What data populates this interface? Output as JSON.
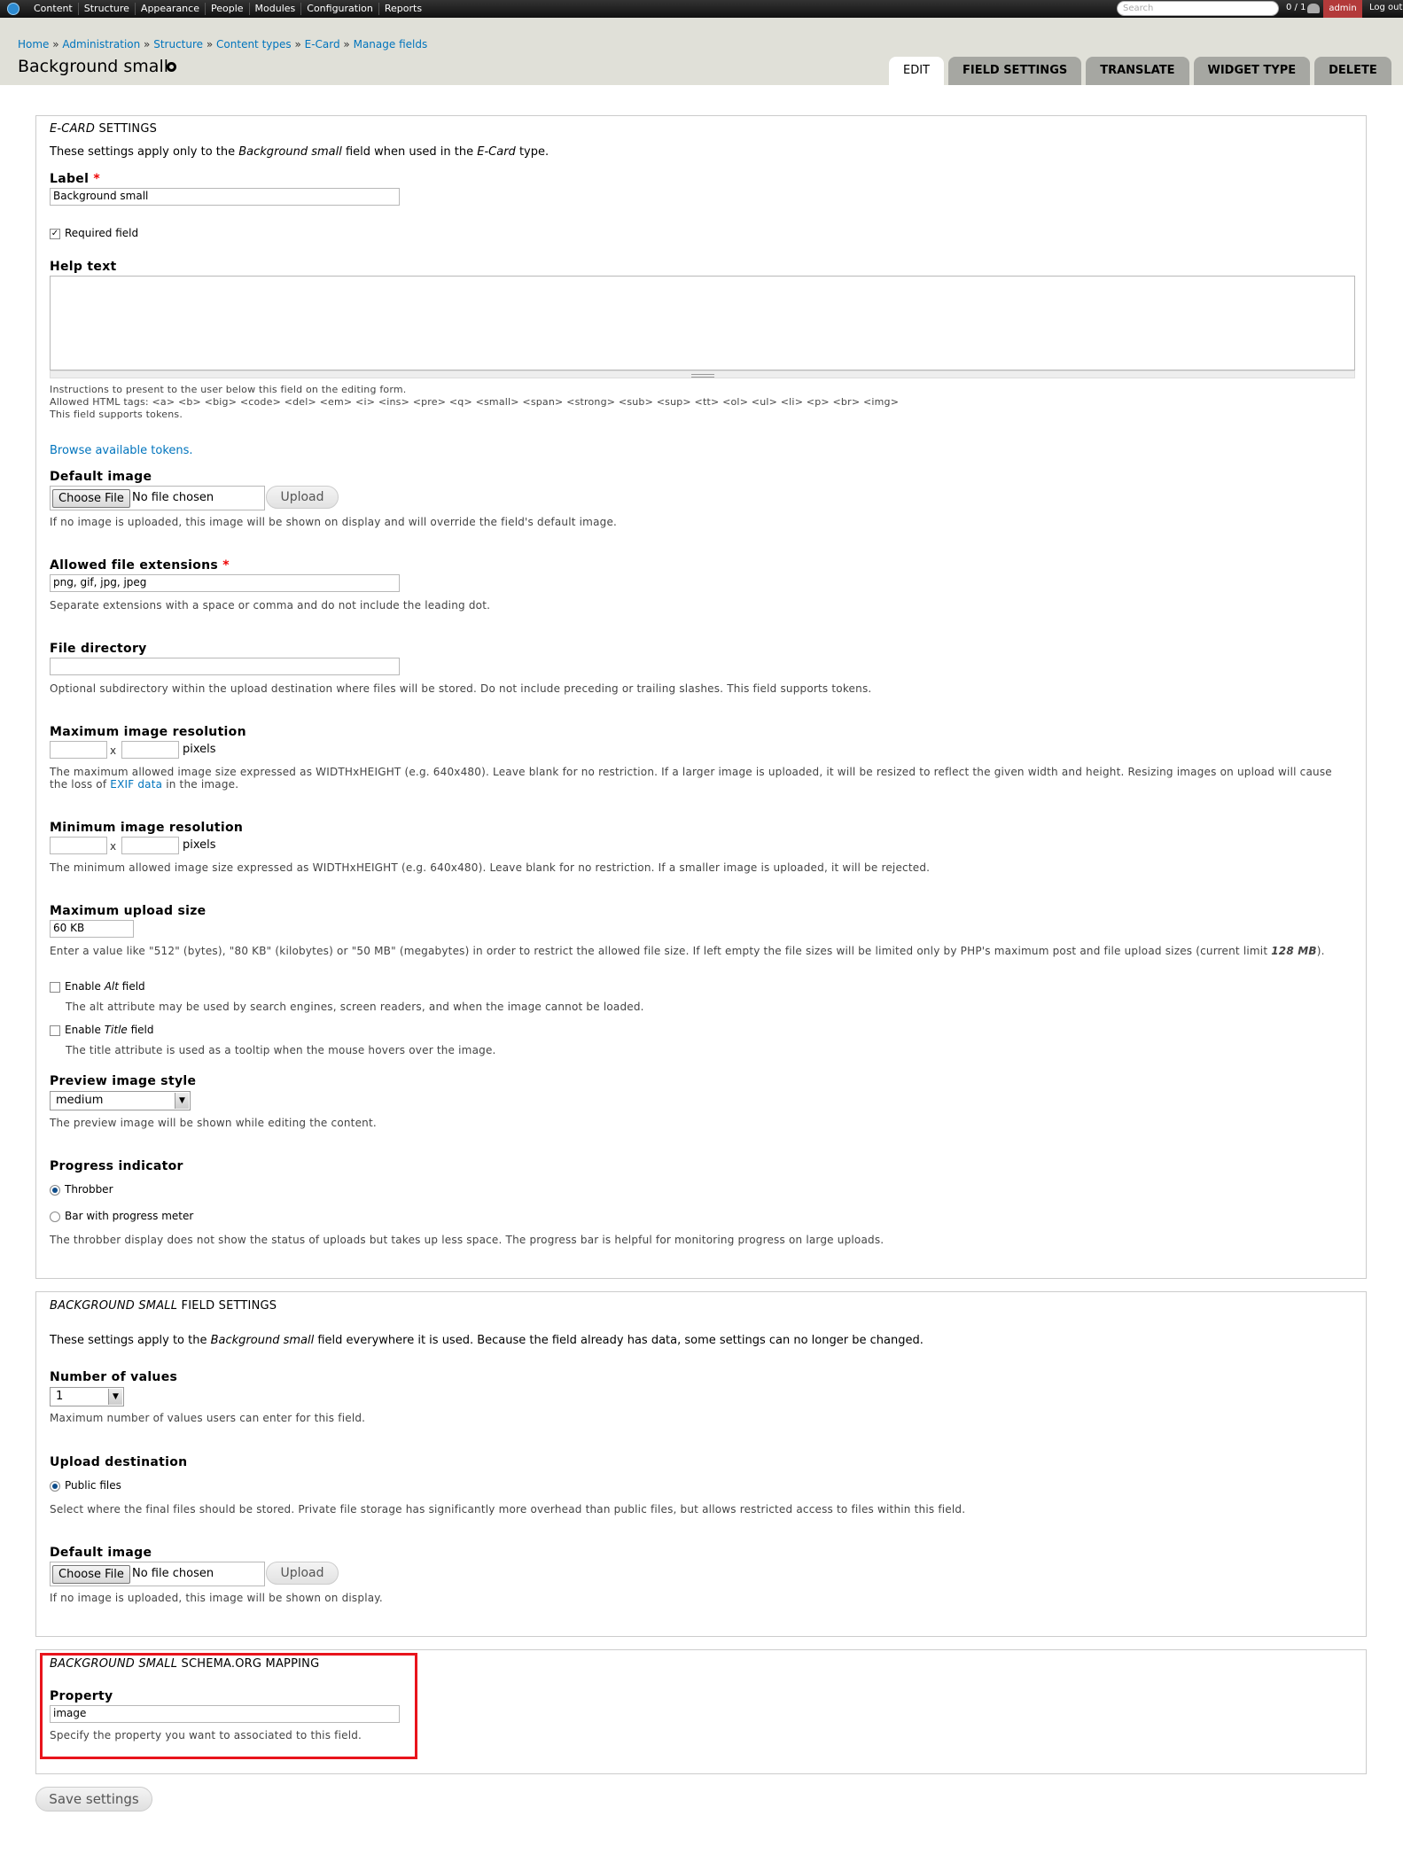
{
  "toolbar": {
    "menu": [
      "Content",
      "Structure",
      "Appearance",
      "People",
      "Modules",
      "Configuration",
      "Reports"
    ],
    "search_placeholder": "Search",
    "users_count": "0 / 1",
    "username": "admin",
    "logout": "Log out"
  },
  "header": {
    "breadcrumb": [
      "Home",
      "Administration",
      "Structure",
      "Content types",
      "E-Card",
      "Manage fields"
    ],
    "title": "Background small",
    "tabs": [
      "EDIT",
      "FIELD SETTINGS",
      "TRANSLATE",
      "WIDGET TYPE",
      "DELETE"
    ]
  },
  "ecard": {
    "legend_em": "E-Card",
    "legend_rest": " settings",
    "intro_pre": "These settings apply only to the ",
    "intro_field": "Background small",
    "intro_mid": " field when used in the ",
    "intro_type": "E-Card",
    "intro_post": " type.",
    "label_label": "Label",
    "label_value": "Background small",
    "required_label": "Required field",
    "help_label": "Help text",
    "help_desc1": "Instructions to present to the user below this field on the editing form.",
    "help_desc2": "Allowed HTML tags: <a> <b> <big> <code> <del> <em> <i> <ins> <pre> <q> <small> <span> <strong> <sub> <sup> <tt> <ol> <ul> <li> <p> <br> <img>",
    "help_desc3": "This field supports tokens.",
    "tokens_link": "Browse available tokens.",
    "default_image_label": "Default image",
    "choose_file": "Choose File",
    "no_file": "No file chosen",
    "upload": "Upload",
    "default_image_desc": "If no image is uploaded, this image will be shown on display and will override the field's default image.",
    "extensions_label": "Allowed file extensions",
    "extensions_value": "png, gif, jpg, jpeg",
    "extensions_desc": "Separate extensions with a space or comma and do not include the leading dot.",
    "directory_label": "File directory",
    "directory_value": "",
    "directory_desc": "Optional subdirectory within the upload destination where files will be stored. Do not include preceding or trailing slashes. This field supports tokens.",
    "max_res_label": "Maximum image resolution",
    "x": "x",
    "pixels": "pixels",
    "max_res_desc1": "The maximum allowed image size expressed as WIDTHxHEIGHT (e.g. 640x480). Leave blank for no restriction. If a larger image is uploaded, it will be resized to reflect the given width and height. Resizing images on upload will cause the loss of ",
    "max_res_link": "EXIF data",
    "max_res_desc2": " in the image.",
    "min_res_label": "Minimum image resolution",
    "min_res_desc": "The minimum allowed image size expressed as WIDTHxHEIGHT (e.g. 640x480). Leave blank for no restriction. If a smaller image is uploaded, it will be rejected.",
    "max_upload_label": "Maximum upload size",
    "max_upload_value": "60 KB",
    "max_upload_desc_pre": "Enter a value like \"512\" (bytes), \"80 KB\" (kilobytes) or \"50 MB\" (megabytes) in order to restrict the allowed file size. If left empty the file sizes will be limited only by PHP's maximum post and file upload sizes (current limit ",
    "max_upload_limit": "128 MB",
    "max_upload_desc_post": ").",
    "alt_pre": "Enable ",
    "alt_em": "Alt",
    "alt_post": " field",
    "alt_desc": "The alt attribute may be used by search engines, screen readers, and when the image cannot be loaded.",
    "title_pre": "Enable ",
    "title_em": "Title",
    "title_post": " field",
    "title_desc": "The title attribute is used as a tooltip when the mouse hovers over the image.",
    "preview_label": "Preview image style",
    "preview_value": "medium",
    "preview_desc": "The preview image will be shown while editing the content.",
    "progress_label": "Progress indicator",
    "progress_opt1": "Throbber",
    "progress_opt2": "Bar with progress meter",
    "progress_desc": "The throbber display does not show the status of uploads but takes up less space. The progress bar is helpful for monitoring progress on large uploads."
  },
  "field_settings": {
    "legend_em": "Background small",
    "legend_rest": " field settings",
    "intro_pre": "These settings apply to the ",
    "intro_field": "Background small",
    "intro_post": " field everywhere it is used. Because the field already has data, some settings can no longer be changed.",
    "num_values_label": "Number of values",
    "num_values_value": "1",
    "num_values_desc": "Maximum number of values users can enter for this field.",
    "upload_dest_label": "Upload destination",
    "upload_dest_opt": "Public files",
    "upload_dest_desc": "Select where the final files should be stored. Private file storage has significantly more overhead than public files, but allows restricted access to files within this field.",
    "default_image_label": "Default image",
    "choose_file": "Choose File",
    "no_file": "No file chosen",
    "upload": "Upload",
    "default_image_desc": "If no image is uploaded, this image will be shown on display."
  },
  "schema": {
    "legend_em": "Background small",
    "legend_rest": " schema.org mapping",
    "property_label": "Property",
    "property_value": "image",
    "property_desc": "Specify the property you want to associated to this field."
  },
  "actions": {
    "save": "Save settings"
  },
  "colors": {
    "highlight": "#e8141c",
    "link": "#0074bd",
    "admin_badge": "#b33a3a"
  }
}
